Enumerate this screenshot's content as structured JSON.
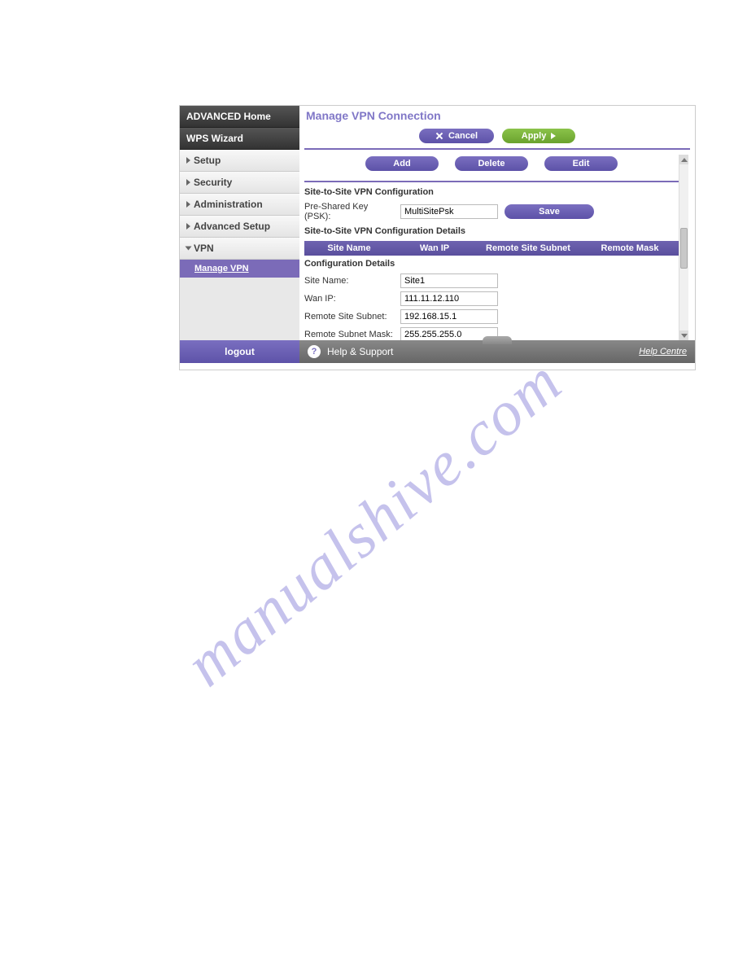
{
  "watermark": "manualshive.com",
  "sidebar": {
    "tabs": [
      "ADVANCED Home",
      "WPS Wizard"
    ],
    "items": [
      {
        "label": "Setup",
        "expanded": false
      },
      {
        "label": "Security",
        "expanded": false
      },
      {
        "label": "Administration",
        "expanded": false
      },
      {
        "label": "Advanced Setup",
        "expanded": false
      },
      {
        "label": "VPN",
        "expanded": true
      }
    ],
    "sub": "Manage VPN",
    "logout": "logout"
  },
  "page": {
    "title": "Manage VPN Connection",
    "cancel": "Cancel",
    "apply": "Apply",
    "add": "Add",
    "delete": "Delete",
    "edit": "Edit",
    "save": "Save"
  },
  "psk": {
    "section_title": "Site-to-Site VPN Configuration",
    "label": "Pre-Shared Key (PSK):",
    "value": "MultiSitePsk"
  },
  "details": {
    "section_title": "Site-to-Site VPN Configuration Details",
    "headers": {
      "site": "Site Name",
      "wan": "Wan IP",
      "subnet": "Remote Site Subnet",
      "mask": "Remote Mask"
    },
    "config_title": "Configuration Details",
    "fields": {
      "site_name": {
        "label": "Site Name:",
        "value": "Site1"
      },
      "wan_ip": {
        "label": "Wan IP:",
        "value": "111.11.12.110"
      },
      "remote_subnet": {
        "label": "Remote Site Subnet:",
        "value": "192.168.15.1"
      },
      "remote_mask": {
        "label": "Remote Subnet Mask:",
        "value": "255.255.255.0"
      }
    }
  },
  "help": {
    "title": "Help & Support",
    "link": "Help Centre",
    "q": "?"
  }
}
